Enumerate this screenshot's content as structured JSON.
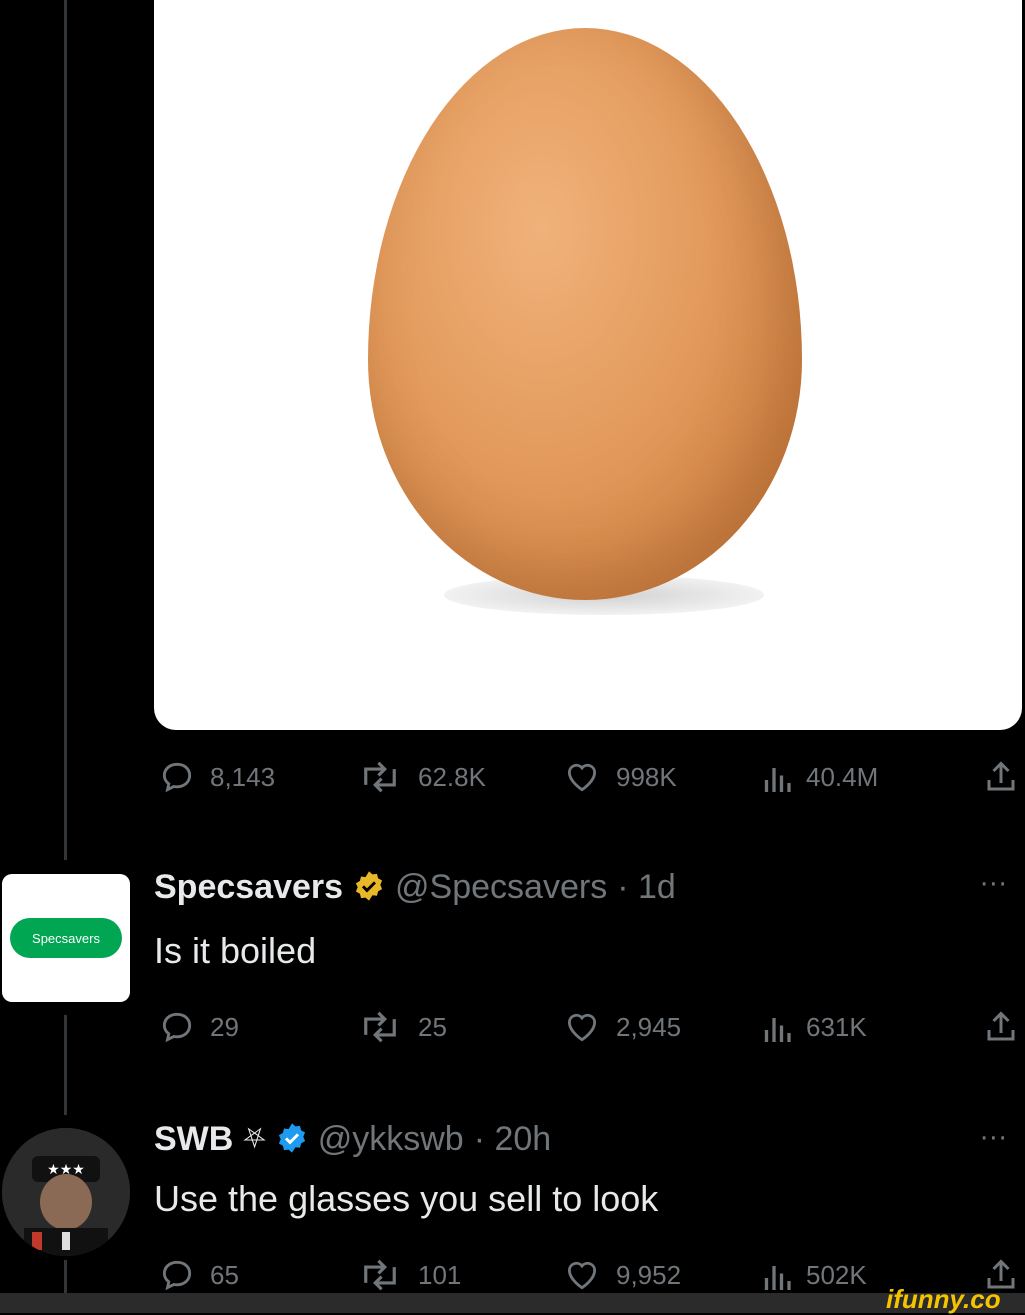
{
  "main_tweet": {
    "stats": {
      "replies": "8,143",
      "retweets": "62.8K",
      "likes": "998K",
      "views": "40.4M"
    }
  },
  "replies": [
    {
      "name": "Specsavers",
      "handle": "@Specsavers",
      "time": "· 1d",
      "text": "Is it boiled",
      "avatar_text": "Specsavers",
      "more": "···",
      "stats": {
        "replies": "29",
        "retweets": "25",
        "likes": "2,945",
        "views": "631K"
      }
    },
    {
      "name": "SWB",
      "name_symbol": "⛧",
      "handle": "@ykkswb",
      "time": "· 20h",
      "text": "Use the glasses you sell to look",
      "more": "···",
      "stats": {
        "replies": "65",
        "retweets": "101",
        "likes": "9,952",
        "views": "502K"
      }
    }
  ],
  "watermark": "ifunny.co",
  "colors": {
    "background": "#000000",
    "muted": "#71767b",
    "text": "#e7e9ea",
    "verified_gold": "#e8b829",
    "verified_blue": "#1d9bf0"
  }
}
